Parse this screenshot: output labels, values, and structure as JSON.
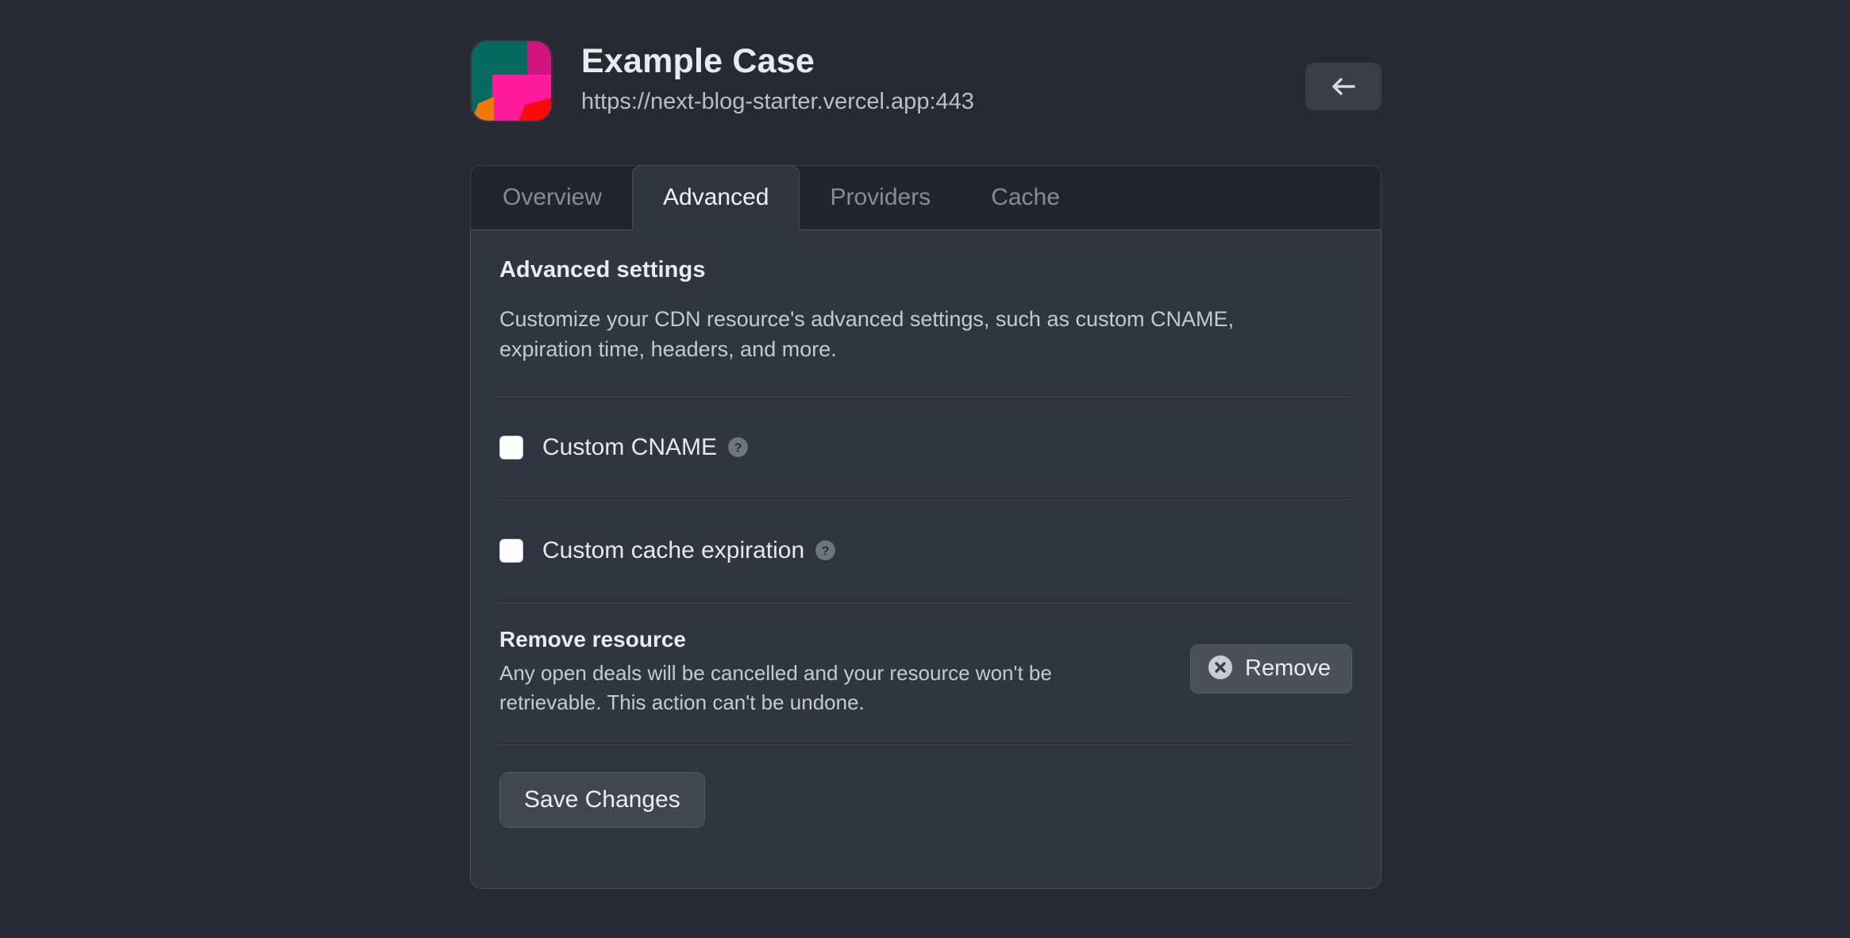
{
  "header": {
    "title": "Example Case",
    "url": "https://next-blog-starter.vercel.app:443",
    "logo_icon": "vercel-app-logo",
    "back_button": {
      "icon": "arrow-left-icon",
      "label": ""
    },
    "colors": {
      "logo_teal": "#046a5f",
      "logo_magenta": "#d1147e",
      "logo_pink": "#ff1b9a",
      "logo_red": "#fa0a0a",
      "logo_orange": "#f07806"
    }
  },
  "tabs": [
    {
      "label": "Overview",
      "active": false
    },
    {
      "label": "Advanced",
      "active": true
    },
    {
      "label": "Providers",
      "active": false
    },
    {
      "label": "Cache",
      "active": false
    }
  ],
  "advanced": {
    "section_title": "Advanced settings",
    "section_desc": "Customize your CDN resource's advanced settings, such as custom CNAME, expiration time, headers, and more.",
    "options": [
      {
        "label": "Custom CNAME",
        "checked": false,
        "help_icon": "help-circle-icon"
      },
      {
        "label": "Custom cache expiration",
        "checked": false,
        "help_icon": "help-circle-icon"
      }
    ],
    "remove": {
      "title": "Remove resource",
      "desc": "Any open deals will be cancelled and your resource won't be retrievable. This action can't be undone.",
      "button_label": "Remove",
      "button_icon": "close-circle-icon"
    },
    "save_label": "Save Changes"
  },
  "theme": {
    "page_bg": "#272a33",
    "panel_bg": "#31353f",
    "tabbar_bg": "#22252e",
    "border": "#4a4e59",
    "text_primary": "#e9ecf1",
    "text_secondary": "#c4c9d2",
    "text_muted": "#868c99"
  }
}
